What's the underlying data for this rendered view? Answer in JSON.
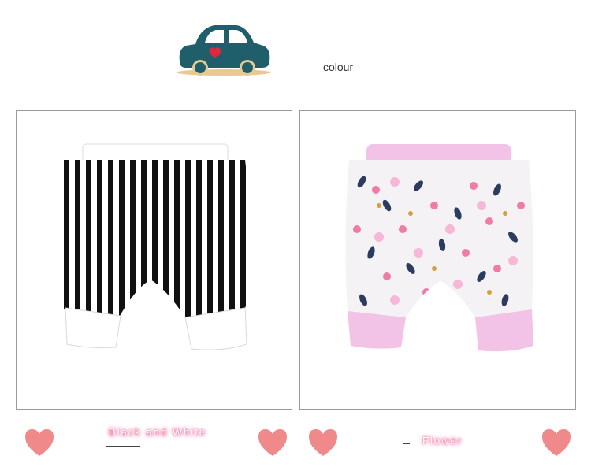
{
  "header": {
    "colour_label": "colour"
  },
  "products": [
    {
      "caption": "Black and White",
      "pattern": "black-white-stripes",
      "waistband_color": "#ffffff",
      "cuff_color": "#ffffff"
    },
    {
      "caption": "Flower",
      "pattern": "floral",
      "waistband_color": "#f2c3e6",
      "cuff_color": "#f2c3e6"
    }
  ],
  "colors": {
    "car_body": "#1f5f6b",
    "heart": "#f08a8a",
    "caption_glow": "#f06a9a"
  },
  "icons": [
    "car-icon",
    "heart-icon"
  ]
}
